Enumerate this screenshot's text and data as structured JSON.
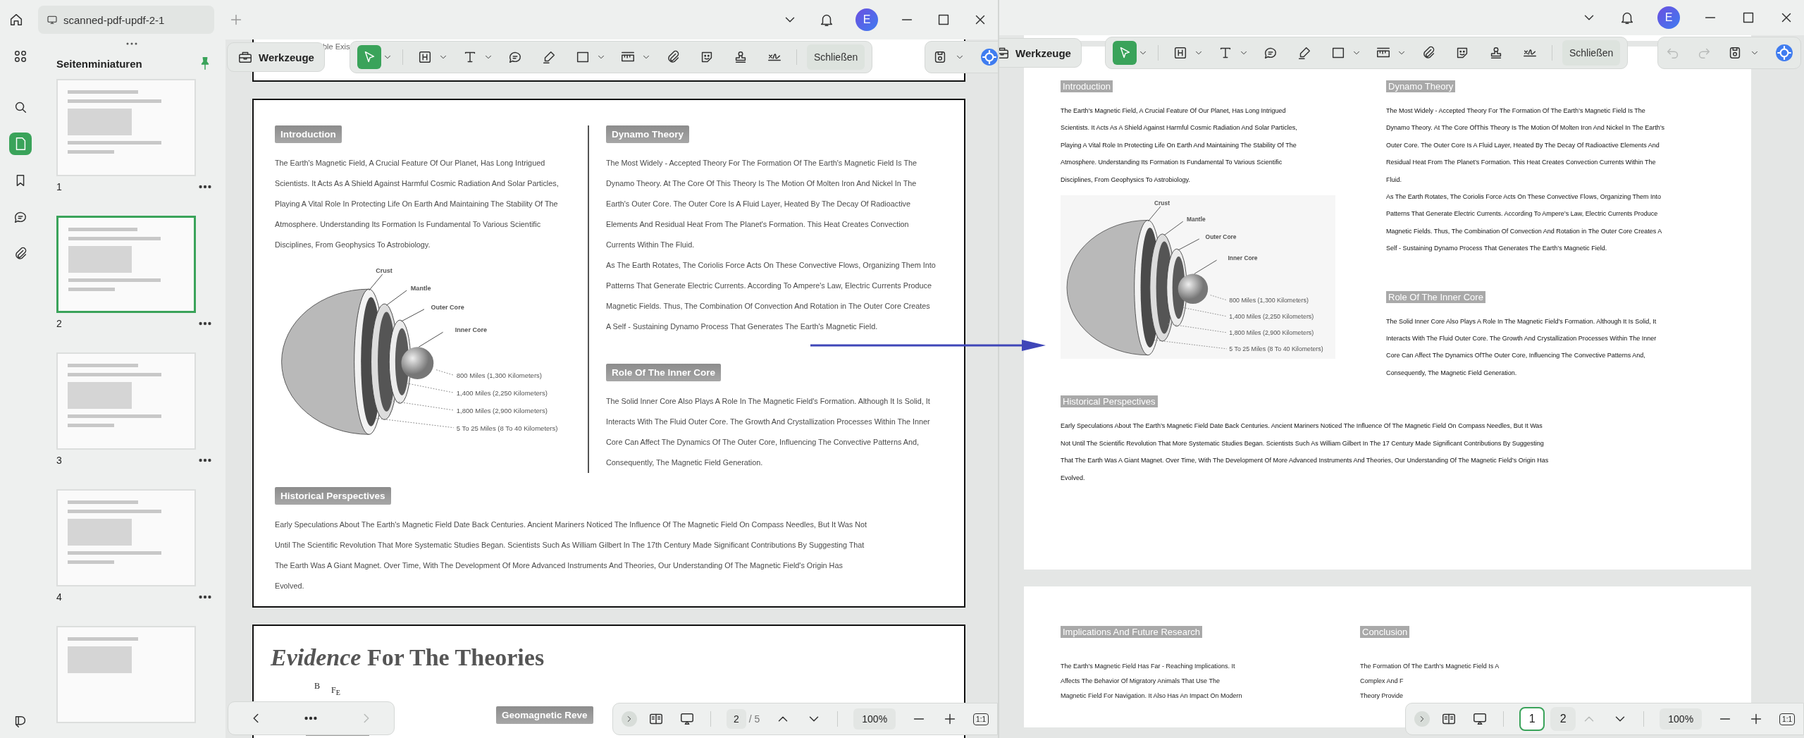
{
  "windows": [
    {
      "kind": "scanned",
      "tab_title": "scanned-pdf-updf-2-1",
      "avatar": "E",
      "sidebar": {
        "title": "Seitenminiaturen",
        "thumbnails": [
          {
            "label": "1",
            "selected": false
          },
          {
            "label": "2",
            "selected": true
          },
          {
            "label": "3",
            "selected": false
          },
          {
            "label": "4",
            "selected": false
          }
        ]
      },
      "toolbar": {
        "tools_label": "Werkzeuge",
        "tools": [
          {
            "selected": true
          },
          {
            "selected": false
          },
          {
            "selected": false
          },
          {
            "selected": false
          },
          {
            "selected": false
          },
          {
            "selected": false
          },
          {
            "selected": false
          },
          {
            "selected": false
          },
          {
            "selected": false
          },
          {
            "selected": false
          },
          {
            "selected": false
          }
        ],
        "close_label": "Schließen"
      },
      "previous_page_fragment": "ble Exis",
      "page": {
        "left_column": {
          "heading": "Introduction",
          "text": "The Earth's Magnetic Field, A Crucial Feature Of Our Planet, Has Long Intrigued Scientists. It Acts As A Shield Against Harmful Cosmic Radiation And Solar Particles, Playing A Vital Role In Protecting Life On Earth And Maintaining The Stability Of The Atmosphere. Understanding Its Formation Is Fundamental To Various Scientific Disciplines, From Geophysics To Astrobiology.",
          "diagram": {
            "layer_labels": [
              "Crust",
              "Mantle",
              "Outer Core",
              "Inner Core"
            ],
            "depth_labels": [
              "800 Miles (1,300 Kilometers)",
              "1,400 Miles (2,250 Kilometers)",
              "1,800 Miles (2,900 Kilometers)",
              "5 To 25 Miles (8 To 40 Kilometers)"
            ]
          }
        },
        "right_column": [
          {
            "heading": "Dynamo Theory",
            "paragraphs": [
              "The Most Widely - Accepted Theory For The Formation Of The Earth's Magnetic Field Is The Dynamo Theory. At The Core Of This Theory Is The Motion Of Molten Iron And Nickel In The Earth's Outer Core. The Outer Core Is A Fluid Layer, Heated By The Decay Of Radioactive Elements And Residual Heat From The Planet's Formation. This Heat Creates Convection Currents Within The Fluid.",
              "As The Earth Rotates, The Coriolis Force Acts On These Convective Flows, Organizing Them Into Patterns That Generate Electric Currents. According To Ampere's Law, Electric Currents Produce Magnetic Fields. Thus, The Combination Of Convection And Rotation in The Outer Core Creates A Self - Sustaining Dynamo Process That Generates The Earth's Magnetic Field."
            ]
          },
          {
            "heading": "Role Of The Inner Core",
            "paragraphs": [
              "The Solid Inner Core Also Plays A Role In The Magnetic Field's Formation. Although It Is Solid, It Interacts With The Fluid Outer Core. The Growth And Crystallization Processes Within The Inner Core Can Affect The Dynamics Of The Outer Core, Influencing The Convective Patterns And, Consequently, The Magnetic Field Generation."
            ]
          }
        ],
        "bottom_section": {
          "heading": "Historical Perspectives",
          "paragraphs": [
            "Early Speculations About The Earth's Magnetic Field Date Back Centuries. Ancient Mariners Noticed The Influence Of The Magnetic Field On Compass Needles, But It Was Not Until The Scientific Revolution That More Systematic Studies Began. Scientists Such As William Gilbert In The 17th Century Made Significant Contributions By Suggesting That The Earth Was A Giant Magnet. Over Time, With The Development Of More Advanced Instruments And Theories, Our Understanding Of The Magnetic Field's Origin Has Evolved."
          ]
        }
      },
      "next_page": {
        "title": "*Evidence* For The Theories",
        "figure_labels": [
          "B",
          "F$_{E}$"
        ],
        "cut_heading": "Geomagnetic Reve"
      },
      "bottom_bar": {
        "page_input": "2",
        "page_total": "/ 5",
        "zoom": "100%",
        "fit": "1:1",
        "prev_disabled": false
      }
    },
    {
      "kind": "clean",
      "avatar": "E",
      "toolbar": {
        "tools_label": "Werkzeuge",
        "tools": [
          {
            "selected": true
          },
          {
            "selected": false
          },
          {
            "selected": false
          },
          {
            "selected": false
          },
          {
            "selected": false
          },
          {
            "selected": false
          },
          {
            "selected": false
          },
          {
            "selected": false
          },
          {
            "selected": false
          },
          {
            "selected": false
          },
          {
            "selected": false
          }
        ],
        "close_label": "Schließen",
        "history_disabled": true
      },
      "page": {
        "left_column": {
          "heading": "Introduction",
          "text": "The Earth’s Magnetic Field, A Crucial Feature Of Our Planet, Has Long Intrigued Scientists. It Acts As A Shield Against Harmful Cosmic Radiation And Solar Particles, Playing A Vital Role In Protecting Life On Earth And Maintaining The Stability Of The Atmosphere. Understanding Its Formation Is Fundamental To Various Scientific Disciplines, From Geophysics To Astrobiology.",
          "diagram": {
            "layer_labels": [
              "Crust",
              "Mantle",
              "Outer Core",
              "Inner Core"
            ],
            "depth_labels": [
              "800 Miles (1,300 Kilometers)",
              "1,400 Miles (2,250 Kilometers)",
              "1,800 Miles (2,900 Kilometers)",
              "5 To 25 Miles (8 To 40 Kilometers)"
            ]
          }
        },
        "right_column": [
          {
            "heading": "Dynamo Theory",
            "paragraphs": [
              "The Most Widely - Accepted Theory For The Formation Of The Earth’s Magnetic Field Is The Dynamo Theory. At The Core OfThis Theory Is The Motion Of Molten Iron And Nickel In The Earth’s Outer Core. The Outer Core Is A Fluid Layer, Heated By The Decay Of Radioactive Elements And Residual Heat From The Planet’s Formation. This Heat Creates Convection Currents Within The Fluid.",
              "As The Earth Rotates, The Coriolis Force Acts On These Convective Flows, Organizing Them Into Patterns That Generate Electric Currents. According To Ampere’s Law, Electric Currents Produce Magnetic Fields. Thus, The Combination Of Convection And Rotation in The Outer Core Creates A Self - Sustaining Dynamo Process That Generates The Earth’s Magnetic Field."
            ]
          },
          {
            "heading": "Role Of The Inner Core",
            "paragraphs": [
              "The Solid Inner Core Also Plays A Role In The Magnetic Field’s Formation. Although It Is Solid, It Interacts With The Fluid Outer Core. The Growth And Crystallization Processes Within The Inner Core Can Affect The Dynamics OfThe Outer Core, Influencing The Convective Patterns And, Consequently, The Magnetic Field Generation."
            ]
          }
        ],
        "bottom_section": {
          "heading": "Historical Perspectives",
          "paragraphs": [
            "Early Speculations About The Earth’s Magnetic Field Date Back Centuries. Ancient Mariners Noticed The Influence Of The Magnetic Field On Compass Needles, But It Was Not Until The Scientific Revolution That More Systematic Studies Began. Scientists Such As William Gilbert In The 17 Century Made Significant Contributions By Suggesting That The Earth Was A Giant Magnet. Over Time, With The Development Of More Advanced Instruments And Theories, Our Understanding Of The Magnetic Field’s Origin Has Evolved."
          ]
        }
      },
      "next_page": {
        "sections": [
          {
            "heading": "Implications And Future Research",
            "lines": [
              "The Earth’s Magnetic Field Has Far - Reaching Implications. It",
              "Affects The Behavior Of Migratory Animals That Use The",
              "Magnetic Field For Navigation. It Also Has An Impact On Modern"
            ]
          },
          {
            "heading": "Conclusion",
            "lines": [
              "The Formation Of The Earth’s Magnetic Field Is A",
              "Complex And F",
              "Theory Provide"
            ]
          }
        ]
      },
      "bottom_bar": {
        "pages": [
          {
            "label": "1",
            "selected": true
          },
          {
            "label": "2",
            "selected": false
          }
        ],
        "zoom": "100%",
        "fit": "1:1",
        "prev_disabled": true
      }
    }
  ]
}
